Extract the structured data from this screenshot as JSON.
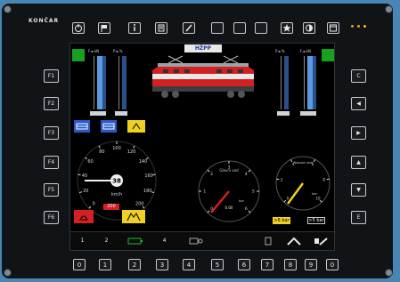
{
  "brand": "KONČAR",
  "top_keys": [
    "power-icon",
    "flag-icon",
    "info-icon",
    "list-icon",
    "wrench-icon",
    "blank-icon",
    "blank-icon",
    "blank-icon",
    "star-icon",
    "contrast-icon",
    "window-icon"
  ],
  "left_keys": [
    "F1",
    "F2",
    "F3",
    "F4",
    "F5",
    "F6"
  ],
  "right_keys": [
    {
      "label": "C",
      "icon": "clear-icon"
    },
    {
      "label": "◀",
      "icon": "arrow-left-icon"
    },
    {
      "label": "▶",
      "icon": "arrow-right-icon"
    },
    {
      "label": "▲",
      "icon": "arrow-up-icon"
    },
    {
      "label": "▼",
      "icon": "arrow-down-icon"
    },
    {
      "label": "E",
      "icon": "enter-icon"
    }
  ],
  "bottom_keys": [
    "0",
    "1",
    "2",
    "3",
    "4",
    "5",
    "6",
    "7",
    "8",
    "9",
    "0"
  ],
  "screen": {
    "logo": "HŽPP",
    "indicator_labels": [
      "F◄ kN",
      "P◄ %",
      "F◄ kN"
    ],
    "speedometer": {
      "ticks": [
        "0",
        "20",
        "40",
        "60",
        "80",
        "100",
        "120",
        "140",
        "160",
        "180",
        "200"
      ],
      "unit": "km/h",
      "speed": "38",
      "target": "200"
    },
    "gauge1": {
      "title": "Glavni vod",
      "ticks": [
        "0",
        "1",
        "2",
        "3",
        "4",
        "5",
        "6"
      ],
      "unit": "bar",
      "value": "0.00"
    },
    "gauge2": {
      "title": "Napojni vod",
      "ticks": [
        "0",
        "2",
        "4",
        "6",
        "8",
        "10"
      ],
      "unit": "bar",
      "yellow_label": ">6 bar",
      "white_label": ">5 bar"
    },
    "tabs": [
      "1",
      "2",
      "",
      "4",
      "",
      "",
      "",
      ""
    ]
  }
}
